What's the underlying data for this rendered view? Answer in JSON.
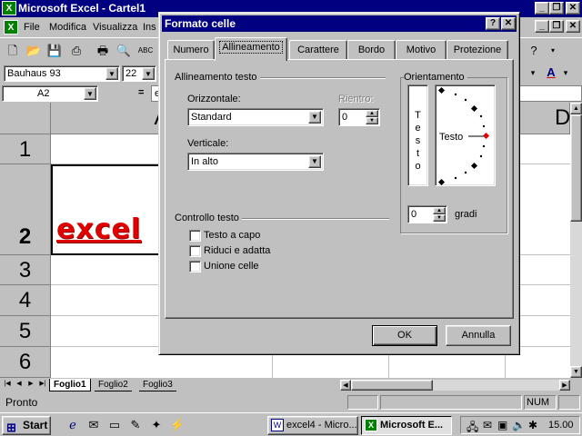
{
  "excel": {
    "title": "Microsoft Excel - Cartel1",
    "menu": [
      "File",
      "Modifica",
      "Visualizza",
      "Ins"
    ],
    "font_name": "Bauhaus 93",
    "font_size": "22",
    "name_box": "A2",
    "formula_equals": "=",
    "formula_value": "e",
    "col_a_header": "A",
    "col_d_header": "D",
    "row_headers": [
      "1",
      "2",
      "3",
      "4",
      "5",
      "6"
    ],
    "cell_a2": "excel",
    "sheet_tabs": [
      "Foglio1",
      "Foglio2",
      "Foglio3"
    ],
    "status": "Pronto",
    "num_indicator": "NUM",
    "colors": {
      "titlebar": "#000080",
      "cell_text": "#e00000"
    }
  },
  "dialog": {
    "title": "Formato celle",
    "help_label": "?",
    "close_label": "✕",
    "tabs": [
      {
        "label": "Numero"
      },
      {
        "label": "Allineamento"
      },
      {
        "label": "Carattere"
      },
      {
        "label": "Bordo"
      },
      {
        "label": "Motivo"
      },
      {
        "label": "Protezione"
      }
    ],
    "active_tab": "Allineamento",
    "alignment": {
      "group_label": "Allineamento testo",
      "horizontal_label": "Orizzontale:",
      "horizontal_value": "Standard",
      "indent_label": "Rientro:",
      "indent_value": "0",
      "vertical_label": "Verticale:",
      "vertical_value": "In alto"
    },
    "orientation": {
      "group_label": "Orientamento",
      "vertical_text": [
        "T",
        "e",
        "s",
        "t",
        "o"
      ],
      "dial_text": "Testo",
      "degrees_value": "0",
      "degrees_label": "gradi"
    },
    "text_control": {
      "group_label": "Controllo testo",
      "options": [
        {
          "label": "Testo a capo",
          "checked": false
        },
        {
          "label": "Riduci e adatta",
          "checked": false
        },
        {
          "label": "Unione celle",
          "checked": false
        }
      ]
    },
    "ok_label": "OK",
    "cancel_label": "Annulla"
  },
  "taskbar": {
    "start_label": "Start",
    "tasks": [
      "excel4 - Micro...",
      "Microsoft E..."
    ],
    "clock": "15.00"
  }
}
